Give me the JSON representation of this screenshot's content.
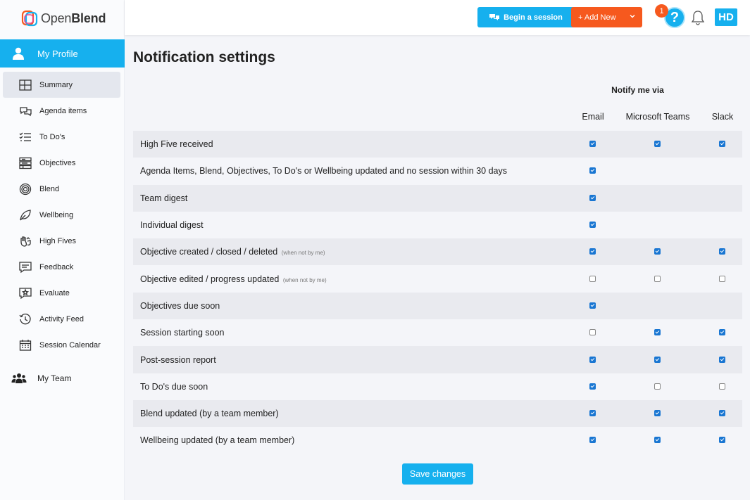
{
  "app": {
    "logo_text_left": "Open",
    "logo_text_right": "Blend"
  },
  "sidebar": {
    "profile_label": "My Profile",
    "items": [
      {
        "label": "Summary",
        "icon": "summary-grid-icon",
        "active": true
      },
      {
        "label": "Agenda items",
        "icon": "chat-bubbles-icon"
      },
      {
        "label": "To Do's",
        "icon": "checklist-icon"
      },
      {
        "label": "Objectives",
        "icon": "objectives-stack-icon"
      },
      {
        "label": "Blend",
        "icon": "target-icon"
      },
      {
        "label": "Wellbeing",
        "icon": "leaf-icon"
      },
      {
        "label": "High Fives",
        "icon": "high-five-icon"
      },
      {
        "label": "Feedback",
        "icon": "feedback-icon"
      },
      {
        "label": "Evaluate",
        "icon": "evaluate-star-icon"
      },
      {
        "label": "Activity Feed",
        "icon": "history-icon"
      },
      {
        "label": "Session Calendar",
        "icon": "calendar-icon"
      }
    ],
    "team_label": "My Team"
  },
  "header": {
    "begin_session_label": "Begin a session",
    "add_new_label": "+ Add New",
    "help_glyph": "?",
    "notification_count": "1",
    "avatar_initials": "HD"
  },
  "main": {
    "title": "Notification settings",
    "notify_via_label": "Notify me via",
    "columns": [
      "Email",
      "Microsoft Teams",
      "Slack"
    ],
    "rows": [
      {
        "label": "High Five received",
        "note": "",
        "email": true,
        "teams": true,
        "slack": true
      },
      {
        "label": "Agenda Items, Blend, Objectives, To Do's or Wellbeing updated and no session within 30 days",
        "note": "",
        "email": true,
        "teams": null,
        "slack": null
      },
      {
        "label": "Team digest",
        "note": "",
        "email": true,
        "teams": null,
        "slack": null
      },
      {
        "label": "Individual digest",
        "note": "",
        "email": true,
        "teams": null,
        "slack": null
      },
      {
        "label": "Objective created / closed / deleted",
        "note": "(when not by me)",
        "email": true,
        "teams": true,
        "slack": true
      },
      {
        "label": "Objective edited / progress updated",
        "note": "(when not by me)",
        "email": false,
        "teams": false,
        "slack": false
      },
      {
        "label": "Objectives due soon",
        "note": "",
        "email": true,
        "teams": null,
        "slack": null
      },
      {
        "label": "Session starting soon",
        "note": "",
        "email": false,
        "teams": true,
        "slack": true
      },
      {
        "label": "Post-session report",
        "note": "",
        "email": true,
        "teams": true,
        "slack": true
      },
      {
        "label": "To Do's due soon",
        "note": "",
        "email": true,
        "teams": false,
        "slack": false
      },
      {
        "label": "Blend updated (by a team member)",
        "note": "",
        "email": true,
        "teams": true,
        "slack": true
      },
      {
        "label": "Wellbeing updated (by a team member)",
        "note": "",
        "email": true,
        "teams": true,
        "slack": true
      }
    ],
    "save_label": "Save changes"
  },
  "colors": {
    "accent": "#16b0ee",
    "orange": "#f6591e",
    "checkbox": "#1976d2"
  }
}
